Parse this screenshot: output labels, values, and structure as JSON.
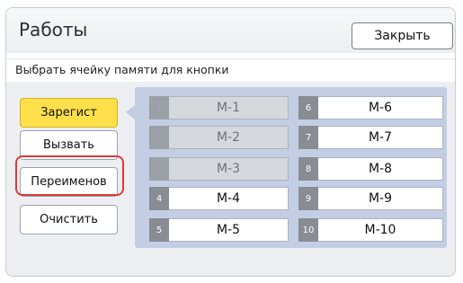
{
  "window": {
    "title": "Работы",
    "close_label": "Закрыть"
  },
  "instruction": "Выбрать ячейку памяти для кнопки",
  "actions": [
    {
      "label": "Зарегист",
      "active": true
    },
    {
      "label": "Вызвать",
      "active": false
    },
    {
      "label": "Переименов",
      "active": false
    },
    {
      "label": "Очистить",
      "active": false
    }
  ],
  "slots": [
    {
      "num": "1",
      "name": "M-1",
      "enabled": false
    },
    {
      "num": "2",
      "name": "M-2",
      "enabled": false
    },
    {
      "num": "3",
      "name": "M-3",
      "enabled": false
    },
    {
      "num": "4",
      "name": "M-4",
      "enabled": true
    },
    {
      "num": "5",
      "name": "M-5",
      "enabled": true
    },
    {
      "num": "6",
      "name": "M-6",
      "enabled": true
    },
    {
      "num": "7",
      "name": "M-7",
      "enabled": true
    },
    {
      "num": "8",
      "name": "M-8",
      "enabled": true
    },
    {
      "num": "9",
      "name": "M-9",
      "enabled": true
    },
    {
      "num": "10",
      "name": "M-10",
      "enabled": true
    }
  ],
  "colors": {
    "active_button": "#ffe04a",
    "panel": "#c3cde3",
    "highlight_outline": "#d93a3a",
    "disabled_slot": "#d5d8dc"
  }
}
